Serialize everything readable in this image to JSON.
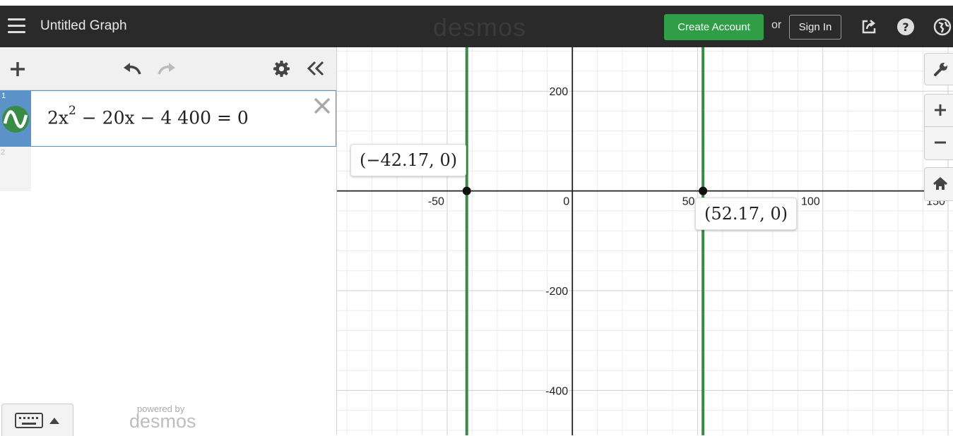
{
  "header": {
    "title": "Untitled Graph",
    "logo": "desmos",
    "create_account": "Create Account",
    "or": "or",
    "sign_in": "Sign In"
  },
  "expressions": [
    {
      "number": "1",
      "x_coef": "2x",
      "exp": "2",
      "rest": " − 20x − 4 400 = 0",
      "color": "#388c46"
    },
    {
      "number": "2"
    }
  ],
  "footer": {
    "powered_by": "powered by",
    "logo": "desmos"
  },
  "graph": {
    "xmin": -94,
    "xmax": 152,
    "ymin": -490,
    "ymax": 288,
    "x_ticks": [
      -50,
      0,
      50,
      100,
      150
    ],
    "y_ticks": [
      200,
      -200,
      -400
    ],
    "x_tick_labels": [
      "-50",
      "0",
      "50",
      "100",
      "150"
    ],
    "y_tick_labels": [
      "200",
      "-200",
      "-400"
    ],
    "minor_step_x": 10,
    "minor_step_y": 40,
    "major_step_x": 50,
    "major_step_y": 200,
    "roots": [
      -42.17,
      52.17
    ],
    "point_labels": [
      "(−42.17, 0)",
      "(52.17, 0)"
    ],
    "curve_color": "#388c46"
  },
  "colors": {
    "header_bg": "#2a2a2a",
    "accent_green": "#2f9e47",
    "expr_blue": "#5b93c8"
  }
}
